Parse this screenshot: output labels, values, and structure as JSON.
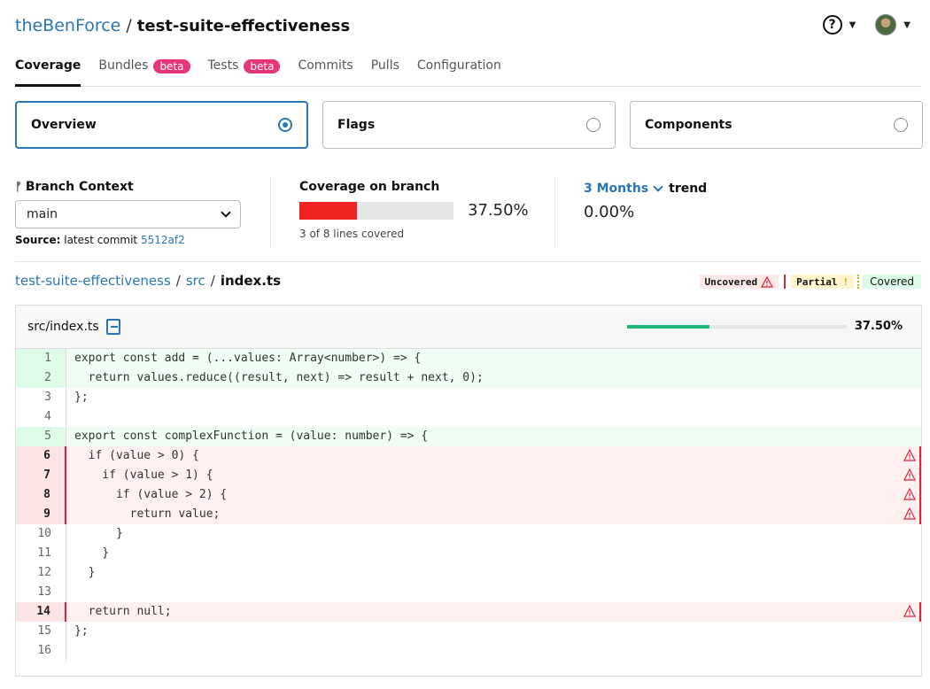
{
  "header": {
    "org": "theBenForce",
    "separator": "/",
    "repo": "test-suite-effectiveness"
  },
  "tabs": [
    {
      "label": "Coverage",
      "active": true
    },
    {
      "label": "Bundles",
      "badge": "beta"
    },
    {
      "label": "Tests",
      "badge": "beta"
    },
    {
      "label": "Commits"
    },
    {
      "label": "Pulls"
    },
    {
      "label": "Configuration"
    }
  ],
  "cards": [
    {
      "label": "Overview",
      "selected": true
    },
    {
      "label": "Flags",
      "selected": false
    },
    {
      "label": "Components",
      "selected": false
    }
  ],
  "branch": {
    "title": "Branch Context",
    "value": "main",
    "source_label": "Source:",
    "source_text": "latest commit",
    "commit": "5512af2"
  },
  "coverage": {
    "title": "Coverage on branch",
    "percent_text": "37.50%",
    "percent": 37.5,
    "lines_text": "3 of 8 lines covered"
  },
  "trend": {
    "period": "3 Months",
    "label": "trend",
    "value": "0.00%"
  },
  "path": {
    "repo": "test-suite-effectiveness",
    "dir": "src",
    "file": "index.ts"
  },
  "legend": {
    "uncovered": "Uncovered",
    "partial": "Partial",
    "covered": "Covered"
  },
  "file": {
    "name": "src/index.ts",
    "percent_text": "37.50%",
    "percent": 37.5
  },
  "code_lines": [
    {
      "n": "1",
      "status": "cov",
      "text": "export const add = (...values: Array<number>) => {"
    },
    {
      "n": "2",
      "status": "cov",
      "text": "  return values.reduce((result, next) => result + next, 0);"
    },
    {
      "n": "3",
      "status": "none",
      "text": "};"
    },
    {
      "n": "4",
      "status": "none",
      "text": ""
    },
    {
      "n": "5",
      "status": "cov",
      "text": "export const complexFunction = (value: number) => {"
    },
    {
      "n": "6",
      "status": "unc",
      "text": "  if (value > 0) {"
    },
    {
      "n": "7",
      "status": "unc",
      "text": "    if (value > 1) {"
    },
    {
      "n": "8",
      "status": "unc",
      "text": "      if (value > 2) {"
    },
    {
      "n": "9",
      "status": "unc",
      "text": "        return value;"
    },
    {
      "n": "10",
      "status": "none",
      "text": "      }"
    },
    {
      "n": "11",
      "status": "none",
      "text": "    }"
    },
    {
      "n": "12",
      "status": "none",
      "text": "  }"
    },
    {
      "n": "13",
      "status": "none",
      "text": ""
    },
    {
      "n": "14",
      "status": "unc",
      "text": "  return null;"
    },
    {
      "n": "15",
      "status": "none",
      "text": "};"
    },
    {
      "n": "16",
      "status": "none",
      "text": ""
    }
  ],
  "colors": {
    "accent": "#2a75b8",
    "badge": "#e8357a",
    "uncovered": "#d9253c",
    "covered_bg": "#dcfce7",
    "coverage_bar": "#f02323",
    "file_bar": "#21b577"
  }
}
